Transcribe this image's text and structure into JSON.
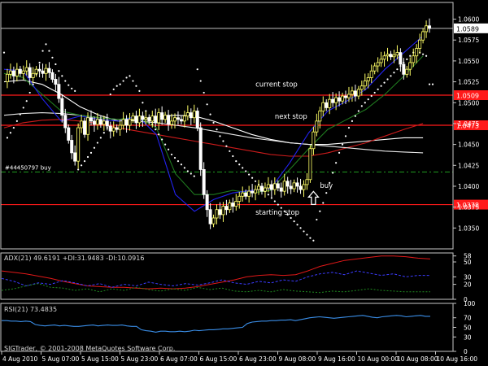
{
  "chart_data": [
    {
      "type": "line",
      "subtype": "candlestick",
      "ylim": [
        1.0325,
        1.062
      ],
      "xlim": [
        0,
        133
      ],
      "grid": false,
      "price_ticks": [
        {
          "label": "1.0600",
          "value": 1.06
        },
        {
          "label": "1.0575",
          "value": 1.0575
        },
        {
          "label": "1.0550",
          "value": 1.055
        },
        {
          "label": "1.0525",
          "value": 1.0525
        },
        {
          "label": "1.0500",
          "value": 1.05
        },
        {
          "label": "1.0475",
          "value": 1.0475
        },
        {
          "label": "1.0450",
          "value": 1.045
        },
        {
          "label": "1.0425",
          "value": 1.0425
        },
        {
          "label": "1.0400",
          "value": 1.04
        },
        {
          "label": "1.0375",
          "value": 1.0375
        },
        {
          "label": "1.0350",
          "value": 1.035
        }
      ],
      "ask_line": {
        "value": 1.0589,
        "label": "1.0589",
        "color": "#c0c0c0"
      },
      "order_line": {
        "value": 1.0417,
        "label": "#44450797 buy",
        "color": "#1f9a1f"
      },
      "stop_lines": [
        {
          "value": 1.0509,
          "label": "1.0509",
          "color": "#ff1a1a"
        },
        {
          "value": 1.0473,
          "label": "1.0473",
          "color": "#ff1a1a"
        },
        {
          "value": 1.0378,
          "label": "1.0378",
          "color": "#ff1a1a"
        }
      ],
      "annotations": [
        {
          "text": "current stop",
          "x": 78,
          "y": 1.0519
        },
        {
          "text": "next stop",
          "x": 84,
          "y": 1.0481
        },
        {
          "text": "starting stop",
          "x": 78,
          "y": 1.0366
        },
        {
          "text": "buy",
          "x": 98,
          "y": 1.0398
        }
      ],
      "buy_arrow": {
        "x": 96,
        "y": 1.0385
      },
      "bullish_color": "#ffff66",
      "bearish_color": "#ffffff",
      "price_path": [
        1.0525,
        1.0534,
        1.0538,
        1.0532,
        1.054,
        1.0535,
        1.0538,
        1.0542,
        1.053,
        1.0535,
        1.054,
        1.0538,
        1.0535,
        1.0541,
        1.0536,
        1.0528,
        1.0522,
        1.0505,
        1.0485,
        1.047,
        1.0455,
        1.044,
        1.043,
        1.047,
        1.0478,
        1.0462,
        1.0482,
        1.0478,
        1.0474,
        1.048,
        1.0474,
        1.0478,
        1.0472,
        1.0466,
        1.047,
        1.0468,
        1.0473,
        1.048,
        1.0473,
        1.048,
        1.0484,
        1.0476,
        1.0484,
        1.048,
        1.0482,
        1.0478,
        1.0484,
        1.0476,
        1.0488,
        1.048,
        1.0485,
        1.0474,
        1.0478,
        1.0482,
        1.048,
        1.0478,
        1.0484,
        1.0488,
        1.0482,
        1.049,
        1.047,
        1.042,
        1.039,
        1.0372,
        1.0355,
        1.0362,
        1.0372,
        1.0366,
        1.0376,
        1.0372,
        1.038,
        1.0376,
        1.0382,
        1.0388,
        1.0392,
        1.0388,
        1.0394,
        1.0392,
        1.0396,
        1.04,
        1.0394,
        1.0398,
        1.0402,
        1.0396,
        1.0403,
        1.0398,
        1.0394,
        1.0406,
        1.04,
        1.0397,
        1.0404,
        1.04,
        1.0396,
        1.0402,
        1.0408,
        1.0445,
        1.0465,
        1.0478,
        1.049,
        1.05,
        1.0494,
        1.0504,
        1.05,
        1.0506,
        1.0502,
        1.0508,
        1.0506,
        1.051,
        1.0514,
        1.0508,
        1.0516,
        1.052,
        1.0526,
        1.053,
        1.0538,
        1.0544,
        1.0548,
        1.0552,
        1.0556,
        1.0558,
        1.0555,
        1.0557,
        1.056,
        1.0546,
        1.0534,
        1.054,
        1.0548,
        1.0556,
        1.0565,
        1.0575,
        1.0585,
        1.0592,
        1.0589
      ],
      "series": [
        {
          "color": "#ffffff",
          "values": [
            1.0525,
            1.0527,
            1.0522,
            1.051,
            1.0495,
            1.0485,
            1.0478,
            1.048,
            1.0483,
            1.0485,
            1.0484,
            1.0478,
            1.047,
            1.0462,
            1.0456,
            1.0452,
            1.045,
            1.045,
            1.0452,
            1.0454,
            1.0456,
            1.0458,
            1.0458
          ]
        },
        {
          "color": "#cc1b1b",
          "values": [
            1.047,
            1.0476,
            1.0479,
            1.048,
            1.0478,
            1.0475,
            1.047,
            1.0466,
            1.0462,
            1.0458,
            1.0454,
            1.045,
            1.0446,
            1.0442,
            1.0438,
            1.0436,
            1.0436,
            1.044,
            1.0446,
            1.0452,
            1.046,
            1.0468,
            1.0475
          ]
        },
        {
          "color": "#e8e8e8",
          "values": [
            1.0485,
            1.0487,
            1.0488,
            1.0487,
            1.0485,
            1.0482,
            1.048,
            1.0478,
            1.0476,
            1.0473,
            1.047,
            1.0466,
            1.0462,
            1.0458,
            1.0455,
            1.0452,
            1.045,
            1.0448,
            1.0446,
            1.0444,
            1.0442,
            1.0441,
            1.044
          ]
        },
        {
          "color": "#1f7a1f",
          "values": [
            1.0535,
            1.053,
            1.051,
            1.049,
            1.0485,
            1.0482,
            1.048,
            1.0483,
            1.047,
            1.0415,
            1.039,
            1.039,
            1.0395,
            1.0392,
            1.0395,
            1.042,
            1.0445,
            1.0468,
            1.048,
            1.0492,
            1.051,
            1.0532,
            1.0556
          ]
        },
        {
          "color": "#2222ee",
          "values": [
            1.054,
            1.0538,
            1.0505,
            1.0478,
            1.0484,
            1.048,
            1.0478,
            1.0484,
            1.0462,
            1.039,
            1.037,
            1.0384,
            1.0392,
            1.0395,
            1.0397,
            1.0428,
            1.0464,
            1.049,
            1.0502,
            1.0516,
            1.054,
            1.056,
            1.058
          ]
        }
      ],
      "psar": [
        1.056,
        1.0458,
        1.0464,
        1.047,
        1.0478,
        1.0486,
        1.0494,
        1.0502,
        1.0512,
        1.0522,
        1.0534,
        1.0548,
        1.0562,
        1.057,
        1.0562,
        1.0554,
        1.0546,
        1.0538,
        1.0532,
        1.0526,
        1.0521,
        1.0517,
        1.0514,
        1.042,
        1.0425,
        1.043,
        1.0435,
        1.044,
        1.0446,
        1.0452,
        1.0458,
        1.0464,
        1.047,
        1.051,
        1.0516,
        1.052,
        1.0522,
        1.0526,
        1.053,
        1.0532,
        1.0526,
        1.052,
        1.0514,
        1.05,
        1.049,
        1.0482,
        1.0474,
        1.0468,
        1.0462,
        1.0456,
        1.045,
        1.0444,
        1.0438,
        1.0434,
        1.043,
        1.0426,
        1.0422,
        1.0418,
        1.0415,
        1.0412,
        1.054,
        1.0526,
        1.0512,
        1.0498,
        1.0486,
        1.0476,
        1.0468,
        1.046,
        1.0454,
        1.0448,
        1.0442,
        1.0436,
        1.043,
        1.0426,
        1.0422,
        1.0418,
        1.0414,
        1.041,
        1.0406,
        1.0402,
        1.0398,
        1.0394,
        1.039,
        1.0386,
        1.0382,
        1.0378,
        1.0374,
        1.037,
        1.0366,
        1.0362,
        1.0358,
        1.0354,
        1.035,
        1.0346,
        1.0342,
        1.0338,
        1.0335,
        1.036,
        1.037,
        1.038,
        1.0392,
        1.0404,
        1.0416,
        1.0428,
        1.044,
        1.045,
        1.046,
        1.047,
        1.0478,
        1.0484,
        1.049,
        1.0496,
        1.05,
        1.0504,
        1.0508,
        1.0512,
        1.0516,
        1.052,
        1.0524,
        1.0528,
        1.0532,
        1.0536,
        1.054,
        1.0544,
        1.0548,
        1.0552,
        1.0556,
        1.056,
        1.0562,
        1.056,
        1.0558,
        1.0556,
        1.0522,
        1.0522
      ]
    },
    {
      "type": "line",
      "title": "ADX(21) 49.6191 +DI:31.9483 -DI:10.0916",
      "ylim": [
        0,
        62
      ],
      "ticks": [
        {
          "label": "58",
          "value": 58
        },
        {
          "label": "50",
          "value": 50
        },
        {
          "label": "30",
          "value": 30
        },
        {
          "label": "20",
          "value": 20
        },
        {
          "label": "0",
          "value": 0
        }
      ],
      "series": [
        {
          "color": "#e01818",
          "values": [
            38,
            36,
            34,
            31,
            28,
            24,
            21,
            18,
            17,
            16,
            16,
            15,
            14,
            15,
            14,
            15,
            17,
            20,
            23,
            26,
            30,
            32,
            33,
            32,
            33,
            38,
            44,
            48,
            52,
            54,
            56,
            58,
            58,
            57,
            55,
            54
          ]
        },
        {
          "color": "#3b3bff",
          "dash": "3,2",
          "values": [
            28,
            24,
            18,
            22,
            20,
            25,
            22,
            18,
            21,
            16,
            20,
            18,
            23,
            20,
            18,
            21,
            19,
            22,
            26,
            22,
            20,
            24,
            22,
            26,
            24,
            30,
            34,
            36,
            33,
            38,
            35,
            32,
            34,
            30,
            32,
            32
          ]
        },
        {
          "color": "#1f8a1f",
          "dash": "2,2",
          "values": [
            12,
            14,
            18,
            21,
            16,
            15,
            12,
            14,
            10,
            14,
            12,
            16,
            13,
            11,
            14,
            12,
            16,
            13,
            15,
            11,
            10,
            12,
            10,
            13,
            11,
            10,
            9,
            11,
            10,
            12,
            14,
            12,
            11,
            10,
            10,
            10
          ]
        }
      ]
    },
    {
      "type": "line",
      "title": "RSI(21) 73.4835",
      "ylim": [
        0,
        100
      ],
      "ticks": [
        {
          "label": "100",
          "value": 100
        },
        {
          "label": "70",
          "value": 70
        },
        {
          "label": "50",
          "value": 50
        },
        {
          "label": "30",
          "value": 30
        },
        {
          "label": "0",
          "value": 0
        }
      ],
      "series": [
        {
          "color": "#3a8ee8",
          "values": [
            64,
            64,
            63,
            63,
            62,
            63,
            62,
            56,
            54,
            53,
            54,
            55,
            53,
            54,
            53,
            52,
            52,
            53,
            54,
            55,
            53,
            54,
            55,
            54,
            54,
            55,
            53,
            52,
            52,
            45,
            43,
            42,
            40,
            42,
            42,
            41,
            41,
            42,
            41,
            42,
            44,
            43,
            44,
            45,
            45,
            46,
            47,
            47,
            48,
            49,
            50,
            58,
            61,
            62,
            63,
            63,
            64,
            64,
            65,
            65,
            66,
            64,
            66,
            68,
            70,
            71,
            72,
            71,
            70,
            69,
            70,
            71,
            72,
            73,
            74,
            75,
            73,
            71,
            70,
            72,
            73,
            74,
            75,
            74,
            72,
            73,
            74,
            75,
            73,
            73
          ]
        }
      ],
      "x_tick_labels": [
        "4 Aug 2010",
        "5 Aug 07:00",
        "5 Aug 15:00",
        "5 Aug 23:00",
        "6 Aug 07:00",
        "6 Aug 15:00",
        "6 Aug 23:00",
        "9 Aug 08:00",
        "9 Aug 16:00",
        "10 Aug 00:00",
        "10 Aug 08:00",
        "10 Aug 16:00"
      ],
      "copyright": "SIGTrader, © 2001-2008 MetaQuotes Software Corp."
    }
  ]
}
